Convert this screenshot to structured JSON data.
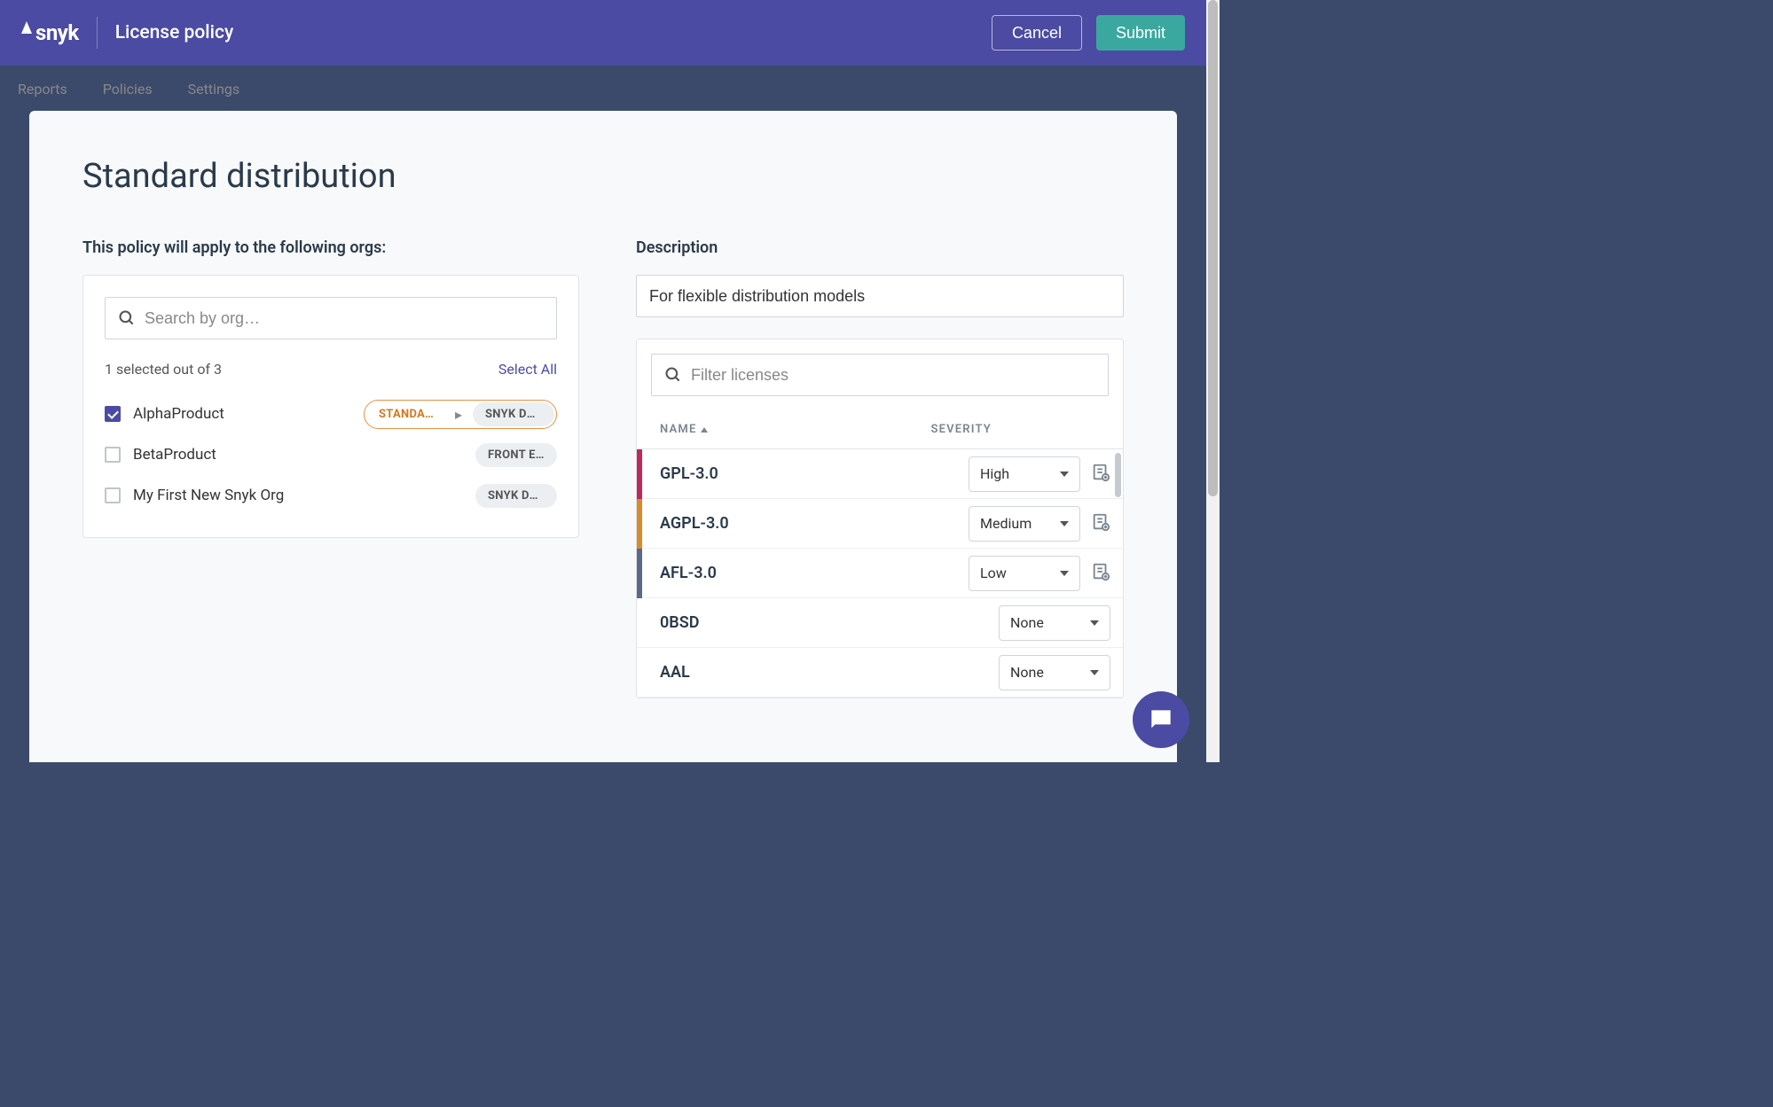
{
  "header": {
    "logo_text": "snyk",
    "title": "License policy",
    "cancel": "Cancel",
    "submit": "Submit"
  },
  "bg_nav": {
    "reports": "Reports",
    "policies": "Policies",
    "settings": "Settings"
  },
  "page": {
    "title": "Standard distribution",
    "orgs_label": "This policy will apply to the following orgs:",
    "search_placeholder": "Search by org…",
    "selected_text": "1 selected out of 3",
    "select_all": "Select All",
    "orgs": [
      {
        "name": "AlphaProduct",
        "checked": true,
        "tag1": "STANDAR…",
        "tag2": "SNYK DEF…"
      },
      {
        "name": "BetaProduct",
        "checked": false,
        "tag2": "FRONT EN…"
      },
      {
        "name": "My First New Snyk Org",
        "checked": false,
        "tag2": "SNYK DEF…"
      }
    ],
    "desc_label": "Description",
    "desc_value": "For flexible distribution models",
    "filter_placeholder": "Filter licenses",
    "col_name": "NAME",
    "col_severity": "SEVERITY",
    "licenses": [
      {
        "name": "GPL-3.0",
        "severity": "High",
        "sev_class": "sev-high",
        "has_note": true
      },
      {
        "name": "AGPL-3.0",
        "severity": "Medium",
        "sev_class": "sev-medium",
        "has_note": true
      },
      {
        "name": "AFL-3.0",
        "severity": "Low",
        "sev_class": "sev-low",
        "has_note": true
      },
      {
        "name": "0BSD",
        "severity": "None",
        "sev_class": "sev-none",
        "has_note": false
      },
      {
        "name": "AAL",
        "severity": "None",
        "sev_class": "sev-none",
        "has_note": false
      }
    ]
  }
}
